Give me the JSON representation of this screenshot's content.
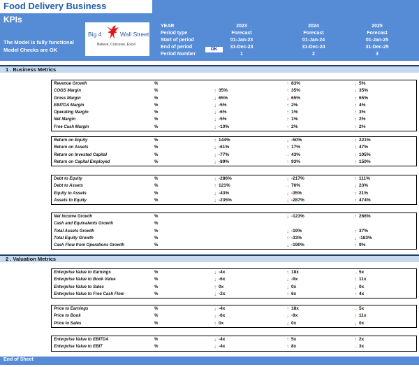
{
  "title": "Food Delivery Business",
  "subtitle": "KPIs",
  "status_messages": [
    "The Model is fully functional",
    "Model Checks are OK"
  ],
  "logo": {
    "left_text": "Big 4",
    "right_text": "Wall Street",
    "tagline": "Believe, Conceive, Excel",
    "icon": "eagle-icon"
  },
  "colors": {
    "header": "#568bd6",
    "section": "#c6d9ef",
    "up": "#4e9a87",
    "down": "#d9572a",
    "side": "#f0b04d"
  },
  "header_labels": [
    "YEAR",
    "Period type",
    "Start of period",
    "End of period",
    "Period Number"
  ],
  "check_badge": "OK",
  "periods": [
    {
      "year": "2023",
      "type": "Forecast",
      "start": "01-Jan-23",
      "end": "31-Dec-23",
      "number": "1"
    },
    {
      "year": "2024",
      "type": "Forecast",
      "start": "01-Jan-24",
      "end": "31-Dec-24",
      "number": "2"
    },
    {
      "year": "2025",
      "type": "Forecast",
      "start": "01-Jan-25",
      "end": "31-Dec-25",
      "number": "3"
    }
  ],
  "sections": [
    {
      "title": "1 .  Business Metrics",
      "groups": [
        {
          "rows": [
            {
              "label": "Revenue Growth",
              "unit": "%",
              "values": [
                null,
                {
                  "dir": "up",
                  "v": "83%"
                },
                {
                  "dir": "down",
                  "v": "5%"
                }
              ]
            },
            {
              "label": "COGS Margin",
              "unit": "%",
              "values": [
                {
                  "dir": "up",
                  "v": "35%"
                },
                {
                  "dir": "up",
                  "v": "35%"
                },
                {
                  "dir": "down",
                  "v": "35%"
                }
              ]
            },
            {
              "label": "Gross Margin",
              "unit": "%",
              "values": [
                {
                  "dir": "down",
                  "v": "65%"
                },
                {
                  "dir": "down",
                  "v": "65%"
                },
                {
                  "dir": "up",
                  "v": "65%"
                }
              ]
            },
            {
              "label": "EBITDA Margin",
              "unit": "%",
              "values": [
                {
                  "dir": "down",
                  "v": "-5%"
                },
                {
                  "dir": "up",
                  "v": "2%"
                },
                {
                  "dir": "up",
                  "v": "4%"
                }
              ]
            },
            {
              "label": "Operating Margin",
              "unit": "%",
              "values": [
                {
                  "dir": "down",
                  "v": "-6%"
                },
                {
                  "dir": "up",
                  "v": "1%"
                },
                {
                  "dir": "up",
                  "v": "3%"
                }
              ]
            },
            {
              "label": "Net Margin",
              "unit": "%",
              "values": [
                {
                  "dir": "down",
                  "v": "-5%"
                },
                {
                  "dir": "up",
                  "v": "1%"
                },
                {
                  "dir": "up",
                  "v": "2%"
                }
              ]
            },
            {
              "label": "Free Cash Margin",
              "unit": "%",
              "values": [
                {
                  "dir": "down",
                  "v": "-10%"
                },
                {
                  "dir": "up",
                  "v": "2%"
                },
                {
                  "dir": "up",
                  "v": "2%"
                }
              ]
            }
          ]
        },
        {
          "rows": [
            {
              "label": "Return on Equity",
              "unit": "%",
              "values": [
                {
                  "dir": "up",
                  "v": "144%"
                },
                {
                  "dir": "down",
                  "v": "-50%"
                },
                {
                  "dir": "up",
                  "v": "221%"
                }
              ]
            },
            {
              "label": "Return on Assets",
              "unit": "%",
              "values": [
                {
                  "dir": "down",
                  "v": "-61%"
                },
                {
                  "dir": "up",
                  "v": "17%"
                },
                {
                  "dir": "up",
                  "v": "47%"
                }
              ]
            },
            {
              "label": "Return on Invested Capital",
              "unit": "%",
              "values": [
                {
                  "dir": "down",
                  "v": "-77%"
                },
                {
                  "dir": "side",
                  "v": "43%"
                },
                {
                  "dir": "up",
                  "v": "105%"
                }
              ]
            },
            {
              "label": "Return on Capital Employed",
              "unit": "%",
              "values": [
                {
                  "dir": "down",
                  "v": "-89%"
                },
                {
                  "dir": "up",
                  "v": "93%"
                },
                {
                  "dir": "up",
                  "v": "150%"
                }
              ]
            }
          ]
        },
        {
          "rows": [
            {
              "label": "Debt to Equity",
              "unit": "%",
              "values": [
                {
                  "dir": "down",
                  "v": "-286%"
                },
                {
                  "dir": "down",
                  "v": "-217%"
                },
                {
                  "dir": "up",
                  "v": "111%"
                }
              ]
            },
            {
              "label": "Debt to Assets",
              "unit": "%",
              "values": [
                {
                  "dir": "up",
                  "v": "121%"
                },
                {
                  "dir": "side",
                  "v": "76%"
                },
                {
                  "dir": "down",
                  "v": "23%"
                }
              ]
            },
            {
              "label": "Equity to Assets",
              "unit": "%",
              "values": [
                {
                  "dir": "down",
                  "v": "-43%"
                },
                {
                  "dir": "down",
                  "v": "-35%"
                },
                {
                  "dir": "up",
                  "v": "21%"
                }
              ]
            },
            {
              "label": "Assets to Equity",
              "unit": "%",
              "values": [
                {
                  "dir": "down",
                  "v": "-235%"
                },
                {
                  "dir": "down",
                  "v": "-287%"
                },
                {
                  "dir": "up",
                  "v": "474%"
                }
              ]
            }
          ]
        },
        {
          "rows": [
            {
              "label": "Net Income Growth",
              "unit": "%",
              "values": [
                null,
                {
                  "dir": "down",
                  "v": "-123%"
                },
                {
                  "dir": "up",
                  "v": "266%"
                }
              ]
            },
            {
              "label": "Cash and Equivalents Growth",
              "unit": "%",
              "values": [
                null,
                null,
                null
              ]
            },
            {
              "label": "Total Assets Growth",
              "unit": "%",
              "values": [
                null,
                {
                  "dir": "down",
                  "v": "-19%"
                },
                {
                  "dir": "up",
                  "v": "37%"
                }
              ]
            },
            {
              "label": "Total Equity Growth",
              "unit": "%",
              "values": [
                null,
                {
                  "dir": "up",
                  "v": "-33%"
                },
                {
                  "dir": "down",
                  "v": "-183%"
                }
              ]
            },
            {
              "label": "Cash Flow from Operations Growth",
              "unit": "%",
              "values": [
                null,
                {
                  "dir": "down",
                  "v": "-190%"
                },
                {
                  "dir": "up",
                  "v": "9%"
                }
              ]
            }
          ]
        }
      ]
    },
    {
      "title": "2 .  Valuation Metrics",
      "groups": [
        {
          "rows": [
            {
              "label": "Enterprise Value to Earnings",
              "unit": "%",
              "values": [
                {
                  "dir": "down",
                  "v": "-4x"
                },
                {
                  "dir": "up",
                  "v": "18x"
                },
                {
                  "dir": "side",
                  "v": "5x"
                }
              ]
            },
            {
              "label": "Enterprise Value to Book Value",
              "unit": "%",
              "values": [
                {
                  "dir": "down",
                  "v": "-6x"
                },
                {
                  "dir": "down",
                  "v": "-9x"
                },
                {
                  "dir": "up",
                  "v": "11x"
                }
              ]
            },
            {
              "label": "Enterprise Value to Sales",
              "unit": "%",
              "values": [
                {
                  "dir": "up",
                  "v": "0x"
                },
                {
                  "dir": "down",
                  "v": "0x"
                },
                {
                  "dir": "down",
                  "v": "0x"
                }
              ]
            },
            {
              "label": "Enterprise Value to Free Cash Flow",
              "unit": "%",
              "values": [
                {
                  "dir": "down",
                  "v": "-2x"
                },
                {
                  "dir": "up",
                  "v": "6x"
                },
                {
                  "dir": "up",
                  "v": "4x"
                }
              ]
            }
          ]
        },
        {
          "rows": [
            {
              "label": "Price to Earnings",
              "unit": "%",
              "values": [
                {
                  "dir": "down",
                  "v": "-4x"
                },
                {
                  "dir": "up",
                  "v": "18x"
                },
                {
                  "dir": "side",
                  "v": "5x"
                }
              ]
            },
            {
              "label": "Price to Book",
              "unit": "%",
              "values": [
                {
                  "dir": "down",
                  "v": "-6x"
                },
                {
                  "dir": "down",
                  "v": "-9x"
                },
                {
                  "dir": "up",
                  "v": "11x"
                }
              ]
            },
            {
              "label": "Price to Sales",
              "unit": "%",
              "values": [
                {
                  "dir": "up",
                  "v": "0x"
                },
                {
                  "dir": "down",
                  "v": "0x"
                },
                {
                  "dir": "down",
                  "v": "0x"
                }
              ]
            }
          ]
        },
        {
          "rows": [
            {
              "label": "Enterprise Value to EBITDA",
              "unit": "%",
              "values": [
                {
                  "dir": "down",
                  "v": "-4x"
                },
                {
                  "dir": "up",
                  "v": "5x"
                },
                {
                  "dir": "up",
                  "v": "2x"
                }
              ]
            },
            {
              "label": "Enterprise Value to EBIT",
              "unit": "%",
              "values": [
                {
                  "dir": "down",
                  "v": "-4x"
                },
                {
                  "dir": "up",
                  "v": "8x"
                },
                {
                  "dir": "side",
                  "v": "3x"
                }
              ]
            }
          ]
        }
      ]
    }
  ],
  "footer": "End of Sheet"
}
